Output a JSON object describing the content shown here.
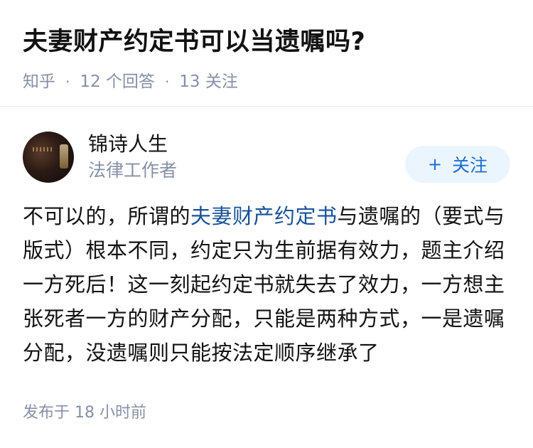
{
  "question": {
    "title": "夫妻财产约定书可以当遗嘱吗?",
    "source": "知乎",
    "answer_count": "12 个回答",
    "follow_count": "13 关注"
  },
  "answer": {
    "author_name": "锦诗人生",
    "author_bio": "法律工作者",
    "follow_label": "关注",
    "follow_icon": "plus-icon",
    "content_prefix": "不可以的，所谓的",
    "content_link": "夫妻财产约定书",
    "content_suffix": "与遗嘱的（要式与版式）根本不同，约定只为生前据有效力，题主介绍一方死后！这一刻起约定书就失去了效力，一方想主张死者一方的财产分配，只能是两种方式，一是遗嘱分配，没遗嘱则只能按法定顺序继承了",
    "publish_time": "发布于 18 小时前"
  },
  "colors": {
    "link": "#175199",
    "muted": "#8590a6",
    "follow_bg": "#ebf5fd",
    "follow_text": "#1a6dd6"
  }
}
